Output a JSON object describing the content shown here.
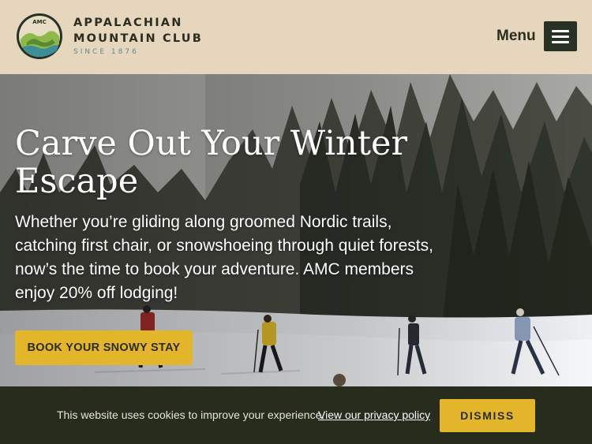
{
  "header": {
    "logo_badge_text": "AMC",
    "org_name_line1": "APPALACHIAN",
    "org_name_line2": "MOUNTAIN CLUB",
    "since": "SINCE 1876",
    "menu_label": "Menu",
    "menu_icon": "hamburger-icon"
  },
  "hero": {
    "title": "Carve Out Your Winter Escape",
    "text": "Whether you’re gliding along groomed Nordic trails, catching first chair, or snowshoeing through quiet forests, now’s the time to book your adventure. AMC members enjoy 20% off lodging!",
    "cta_label": "BOOK YOUR SNOWY STAY",
    "image_subject": "cross-country skiers in snowy pine forest"
  },
  "cookie_bar": {
    "text": "This website uses cookies to improve your experience.",
    "link_label": "View our privacy policy",
    "dismiss_label": "DISMISS"
  },
  "colors": {
    "header_bg": "#e6d6bd",
    "brand_dark": "#273124",
    "accent_yellow": "#e2b52a",
    "cookie_bg": "#272c1d",
    "since_teal": "#5d8c8a"
  }
}
